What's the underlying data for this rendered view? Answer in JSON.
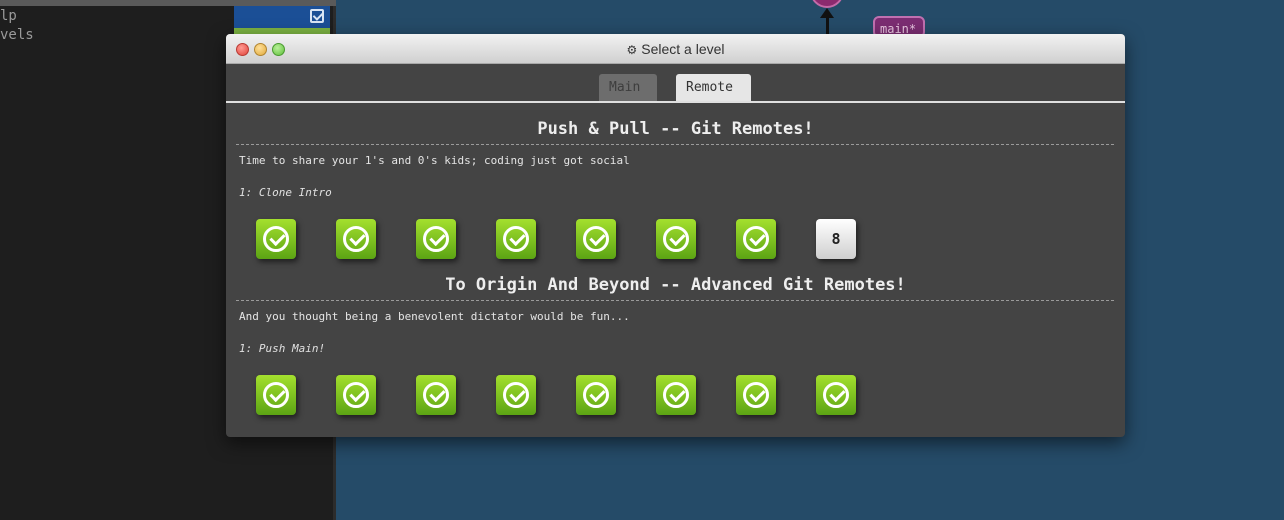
{
  "terminal": {
    "line1": "lp",
    "line2": "vels"
  },
  "graph": {
    "branch_tag": "main*"
  },
  "window": {
    "title": "Select a level",
    "gear_icon": "gear-icon"
  },
  "tabs": [
    {
      "label": "Main",
      "active": false
    },
    {
      "label": "Remote",
      "active": true
    }
  ],
  "sections": [
    {
      "title": "Push & Pull -- Git Remotes!",
      "about": "Time to share your 1's and 0's kids; coding just got social",
      "selected": "1: Clone Intro",
      "levels": [
        {
          "status": "done",
          "label": ""
        },
        {
          "status": "done",
          "label": ""
        },
        {
          "status": "done",
          "label": ""
        },
        {
          "status": "done",
          "label": ""
        },
        {
          "status": "done",
          "label": ""
        },
        {
          "status": "done",
          "label": ""
        },
        {
          "status": "done",
          "label": ""
        },
        {
          "status": "todo",
          "label": "8"
        }
      ]
    },
    {
      "title": "To Origin And Beyond -- Advanced Git Remotes!",
      "about": "And you thought being a benevolent dictator would be fun...",
      "selected": "1: Push Main!",
      "levels": [
        {
          "status": "done",
          "label": ""
        },
        {
          "status": "done",
          "label": ""
        },
        {
          "status": "done",
          "label": ""
        },
        {
          "status": "done",
          "label": ""
        },
        {
          "status": "done",
          "label": ""
        },
        {
          "status": "done",
          "label": ""
        },
        {
          "status": "done",
          "label": ""
        },
        {
          "status": "done",
          "label": ""
        }
      ]
    }
  ],
  "colors": {
    "done": "#6cb81c",
    "todo": "#e8e8e8",
    "window_bg": "#444444",
    "desktop_bg": "#254b68"
  }
}
